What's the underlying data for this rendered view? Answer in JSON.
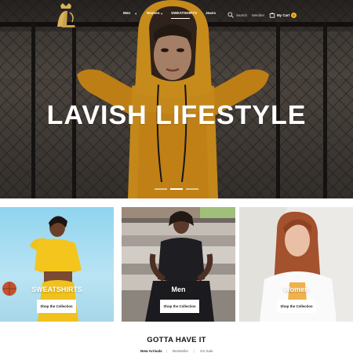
{
  "nav": {
    "items": [
      {
        "label": "Men",
        "dropdown": true
      },
      {
        "label": "Women",
        "dropdown": true
      },
      {
        "label": "SWEATSHIRTS",
        "active": true
      },
      {
        "label": "Jeans",
        "dropdown": false
      }
    ]
  },
  "header": {
    "search_label": "Search",
    "account_label": "Member",
    "cart_label": "My Cart",
    "cart_count": "0",
    "accent": "#f2b81f"
  },
  "hero": {
    "title": "LAVISH LIFESTYLE",
    "slide_count": 3,
    "active_slide": 2
  },
  "categories": [
    {
      "label": "SWEATSHIRTS",
      "button": "Shop the Collection"
    },
    {
      "label": "Men",
      "button": "Shop the Collection"
    },
    {
      "label": "Women",
      "button": "Shop the Collection"
    }
  ],
  "section": {
    "title": "GOTTA HAVE IT",
    "filters": [
      {
        "label": "New Arrivals",
        "active": true
      },
      {
        "label": "Bestseller",
        "active": false
      },
      {
        "label": "On Sale",
        "active": false
      }
    ]
  }
}
